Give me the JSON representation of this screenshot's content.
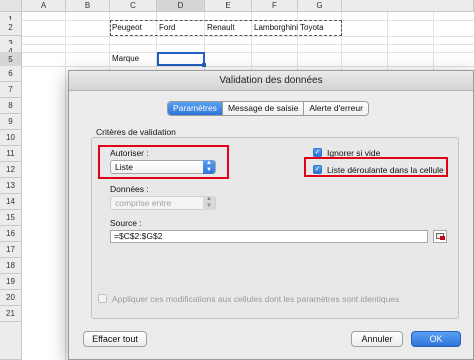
{
  "sheet": {
    "columns": [
      "A",
      "B",
      "C",
      "D",
      "E",
      "F",
      "G"
    ],
    "rows": [
      "1",
      "2",
      "3",
      "4",
      "5",
      "6",
      "7",
      "8",
      "9",
      "10",
      "11",
      "12",
      "13",
      "14",
      "15",
      "16",
      "17",
      "18",
      "19",
      "20",
      "21"
    ],
    "row2": {
      "c": "Peugeot",
      "d": "Ford",
      "e": "Renault",
      "f": "Lamborghini",
      "g": "Toyota"
    },
    "row5": {
      "c": "Marque"
    }
  },
  "dialog": {
    "title": "Validation des données",
    "tabs": [
      "Paramètres",
      "Message de saisie",
      "Alerte d'erreur"
    ],
    "active_tab": "Paramètres",
    "section_label": "Critères de validation",
    "allow_label": "Autoriser :",
    "allow_value": "Liste",
    "data_label": "Données :",
    "data_value": "comprise entre",
    "ignore_blank_label": "Ignorer si vide",
    "ignore_blank_checked": true,
    "dropdown_label": "Liste déroulante dans la cellule",
    "dropdown_checked": true,
    "source_label": "Source :",
    "source_value": "=$C$2:$G$2",
    "apply_label": "Appliquer ces modifications aux cellules dont les paramètres sont identiques",
    "apply_checked": false,
    "clear_button": "Effacer tout",
    "cancel_button": "Annuler",
    "ok_button": "OK"
  },
  "colors": {
    "accent": "#2d74d8",
    "highlight": "#e0001a"
  }
}
